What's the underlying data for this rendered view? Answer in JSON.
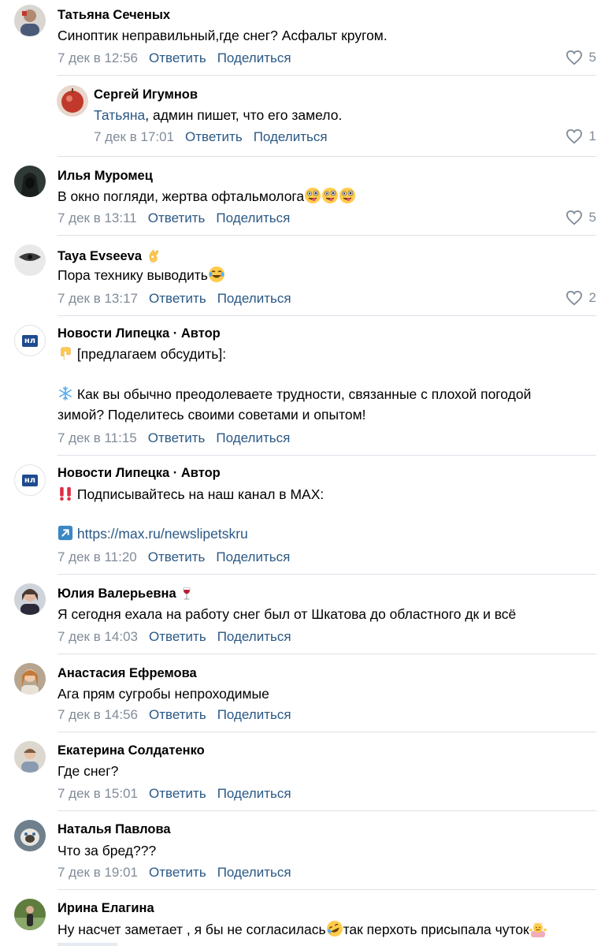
{
  "colors": {
    "link": "#2a5885",
    "meta": "#818c99",
    "separator": "#dce1e6"
  },
  "labels": {
    "reply": "Ответить",
    "share": "Поделиться"
  },
  "comments": [
    {
      "author": "Татьяна Сеченых",
      "text": "Синоптик неправильный,где снег? Асфальт кругом.",
      "date": "7 дек в 12:56",
      "likes": "5"
    },
    {
      "author": "Сергей Игумнов",
      "mention": "Татьяна",
      "text": ", админ пишет, что его замело.",
      "date": "7 дек в 17:01",
      "likes": "1"
    },
    {
      "author": "Илья Муромец",
      "text": "В окно погляди, жертва офтальмолога",
      "emoji": [
        "winking-tongue-face-emoji",
        "winking-tongue-face-emoji",
        "winking-tongue-face-emoji"
      ],
      "date": "7 дек в 13:11",
      "likes": "5"
    },
    {
      "author": "Taya Evseeva",
      "author_emoji": "ok-hand-emoji",
      "text": "Пора технику выводить",
      "emoji": [
        "tears-of-joy-emoji"
      ],
      "date": "7 дек в 13:17",
      "likes": "2"
    },
    {
      "author": "Новости Липецка · Автор",
      "line1": "[предлагаем обсудить]:",
      "line1_emoji": "pointing-down-emoji",
      "line2": "Как вы обычно преодолеваете трудности, связанные с плохой погодой",
      "line2_emoji": "snowflake-emoji",
      "line3": "зимой? Поделитесь своими советами и опытом!",
      "date": "7 дек в 11:15"
    },
    {
      "author": "Новости Липецка · Автор",
      "line1": "Подписывайтесь на наш канал в MAX:",
      "line1_emoji": "double-exclamation-emoji",
      "link": "https://max.ru/newslipetskru",
      "link_emoji": "arrow-up-right-emoji",
      "date": "7 дек в 11:20"
    },
    {
      "author": "Юлия Валерьевна",
      "author_emoji": "wine-glass-emoji",
      "text": "Я сегодня ехала на работу снег был от Шкатова до областного дк и всё",
      "date": "7 дек в 14:03"
    },
    {
      "author": "Анастасия Ефремова",
      "text": "Ага прям сугробы непроходимые",
      "date": "7 дек в 14:56"
    },
    {
      "author": "Екатерина Солдатенко",
      "text": "Где снег?",
      "date": "7 дек в 15:01"
    },
    {
      "author": "Наталья Павлова",
      "text": "Что за бред???",
      "date": "7 дек в 19:01"
    },
    {
      "author": "Ирина Елагина",
      "text": "Ну насчет заметает , я бы не согласилась",
      "text_emoji": "rolling-laughing-emoji",
      "text2": "так перхоть присыпала чуток",
      "text2_emoji": "shrugging-person-emoji"
    }
  ],
  "avatar_badge": "нл"
}
